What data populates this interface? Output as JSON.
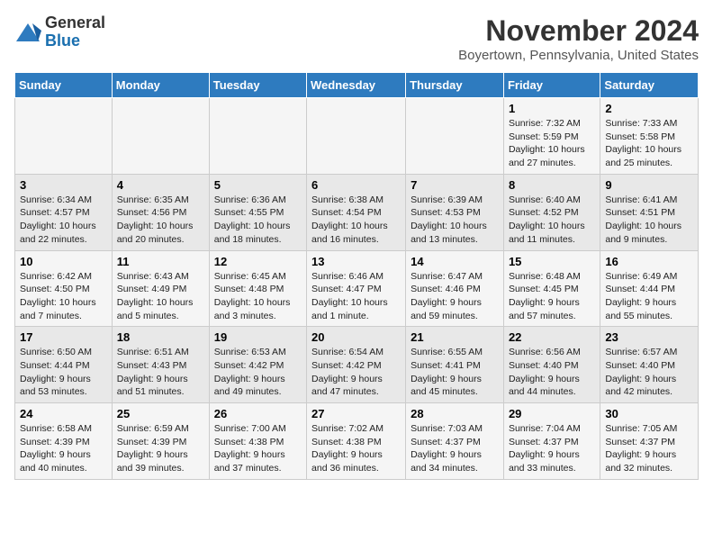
{
  "logo": {
    "text_general": "General",
    "text_blue": "Blue"
  },
  "title": "November 2024",
  "subtitle": "Boyertown, Pennsylvania, United States",
  "days_of_week": [
    "Sunday",
    "Monday",
    "Tuesday",
    "Wednesday",
    "Thursday",
    "Friday",
    "Saturday"
  ],
  "weeks": [
    [
      {
        "day": "",
        "info": ""
      },
      {
        "day": "",
        "info": ""
      },
      {
        "day": "",
        "info": ""
      },
      {
        "day": "",
        "info": ""
      },
      {
        "day": "",
        "info": ""
      },
      {
        "day": "1",
        "info": "Sunrise: 7:32 AM\nSunset: 5:59 PM\nDaylight: 10 hours and 27 minutes."
      },
      {
        "day": "2",
        "info": "Sunrise: 7:33 AM\nSunset: 5:58 PM\nDaylight: 10 hours and 25 minutes."
      }
    ],
    [
      {
        "day": "3",
        "info": "Sunrise: 6:34 AM\nSunset: 4:57 PM\nDaylight: 10 hours and 22 minutes."
      },
      {
        "day": "4",
        "info": "Sunrise: 6:35 AM\nSunset: 4:56 PM\nDaylight: 10 hours and 20 minutes."
      },
      {
        "day": "5",
        "info": "Sunrise: 6:36 AM\nSunset: 4:55 PM\nDaylight: 10 hours and 18 minutes."
      },
      {
        "day": "6",
        "info": "Sunrise: 6:38 AM\nSunset: 4:54 PM\nDaylight: 10 hours and 16 minutes."
      },
      {
        "day": "7",
        "info": "Sunrise: 6:39 AM\nSunset: 4:53 PM\nDaylight: 10 hours and 13 minutes."
      },
      {
        "day": "8",
        "info": "Sunrise: 6:40 AM\nSunset: 4:52 PM\nDaylight: 10 hours and 11 minutes."
      },
      {
        "day": "9",
        "info": "Sunrise: 6:41 AM\nSunset: 4:51 PM\nDaylight: 10 hours and 9 minutes."
      }
    ],
    [
      {
        "day": "10",
        "info": "Sunrise: 6:42 AM\nSunset: 4:50 PM\nDaylight: 10 hours and 7 minutes."
      },
      {
        "day": "11",
        "info": "Sunrise: 6:43 AM\nSunset: 4:49 PM\nDaylight: 10 hours and 5 minutes."
      },
      {
        "day": "12",
        "info": "Sunrise: 6:45 AM\nSunset: 4:48 PM\nDaylight: 10 hours and 3 minutes."
      },
      {
        "day": "13",
        "info": "Sunrise: 6:46 AM\nSunset: 4:47 PM\nDaylight: 10 hours and 1 minute."
      },
      {
        "day": "14",
        "info": "Sunrise: 6:47 AM\nSunset: 4:46 PM\nDaylight: 9 hours and 59 minutes."
      },
      {
        "day": "15",
        "info": "Sunrise: 6:48 AM\nSunset: 4:45 PM\nDaylight: 9 hours and 57 minutes."
      },
      {
        "day": "16",
        "info": "Sunrise: 6:49 AM\nSunset: 4:44 PM\nDaylight: 9 hours and 55 minutes."
      }
    ],
    [
      {
        "day": "17",
        "info": "Sunrise: 6:50 AM\nSunset: 4:44 PM\nDaylight: 9 hours and 53 minutes."
      },
      {
        "day": "18",
        "info": "Sunrise: 6:51 AM\nSunset: 4:43 PM\nDaylight: 9 hours and 51 minutes."
      },
      {
        "day": "19",
        "info": "Sunrise: 6:53 AM\nSunset: 4:42 PM\nDaylight: 9 hours and 49 minutes."
      },
      {
        "day": "20",
        "info": "Sunrise: 6:54 AM\nSunset: 4:42 PM\nDaylight: 9 hours and 47 minutes."
      },
      {
        "day": "21",
        "info": "Sunrise: 6:55 AM\nSunset: 4:41 PM\nDaylight: 9 hours and 45 minutes."
      },
      {
        "day": "22",
        "info": "Sunrise: 6:56 AM\nSunset: 4:40 PM\nDaylight: 9 hours and 44 minutes."
      },
      {
        "day": "23",
        "info": "Sunrise: 6:57 AM\nSunset: 4:40 PM\nDaylight: 9 hours and 42 minutes."
      }
    ],
    [
      {
        "day": "24",
        "info": "Sunrise: 6:58 AM\nSunset: 4:39 PM\nDaylight: 9 hours and 40 minutes."
      },
      {
        "day": "25",
        "info": "Sunrise: 6:59 AM\nSunset: 4:39 PM\nDaylight: 9 hours and 39 minutes."
      },
      {
        "day": "26",
        "info": "Sunrise: 7:00 AM\nSunset: 4:38 PM\nDaylight: 9 hours and 37 minutes."
      },
      {
        "day": "27",
        "info": "Sunrise: 7:02 AM\nSunset: 4:38 PM\nDaylight: 9 hours and 36 minutes."
      },
      {
        "day": "28",
        "info": "Sunrise: 7:03 AM\nSunset: 4:37 PM\nDaylight: 9 hours and 34 minutes."
      },
      {
        "day": "29",
        "info": "Sunrise: 7:04 AM\nSunset: 4:37 PM\nDaylight: 9 hours and 33 minutes."
      },
      {
        "day": "30",
        "info": "Sunrise: 7:05 AM\nSunset: 4:37 PM\nDaylight: 9 hours and 32 minutes."
      }
    ]
  ]
}
